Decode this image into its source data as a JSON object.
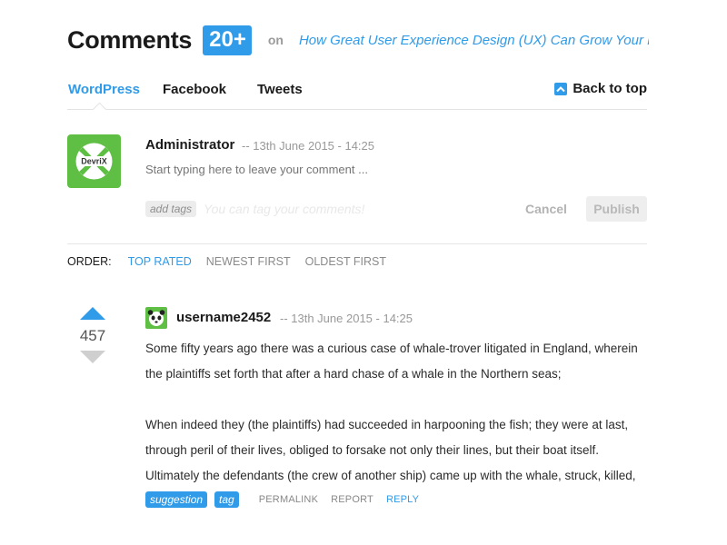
{
  "header": {
    "title": "Comments",
    "count": "20+",
    "on_word": "on",
    "article": "How Great User Experience Design (UX) Can Grow Your Bus.."
  },
  "tabs": [
    {
      "label": "WordPress",
      "active": true
    },
    {
      "label": "Facebook",
      "active": false
    },
    {
      "label": "Tweets",
      "active": false
    }
  ],
  "back_to_top": {
    "label": "Back to top",
    "icon": "arrow-up-icon"
  },
  "composer": {
    "avatar_text": "DevriX",
    "name": "Administrator",
    "date": "-- 13th June 2015 - 14:25",
    "placeholder": "Start typing here to leave your comment ...",
    "add_tags": "add tags",
    "tag_hint": "You can tag your comments!",
    "cancel": "Cancel",
    "publish": "Publish"
  },
  "order": {
    "label": "ORDER:",
    "options": [
      "TOP RATED",
      "NEWEST FIRST",
      "OLDEST FIRST"
    ],
    "active": "TOP RATED"
  },
  "comment": {
    "votes": "457",
    "username": "username2452",
    "date": "-- 13th June 2015 - 14:25",
    "paragraphs": [
      "Some fifty years ago there was a curious case of whale-trover litigated in England, wherein the plaintiffs set forth that after a hard chase of a whale in the Northern seas;",
      "When indeed they (the plaintiffs) had succeeded in harpooning the fish; they were at last, through peril of their lives, obliged to forsake not only their lines, but their boat itself. Ultimately the defendants (the crew of another ship) came up with the whale, struck, killed,"
    ],
    "tags": [
      "suggestion",
      "tag"
    ],
    "actions": {
      "permalink": "PERMALINK",
      "report": "REPORT",
      "reply": "REPLY"
    }
  },
  "colors": {
    "accent": "#2f9be9",
    "avatar_green": "#5fbf44",
    "muted_text": "#999999"
  }
}
